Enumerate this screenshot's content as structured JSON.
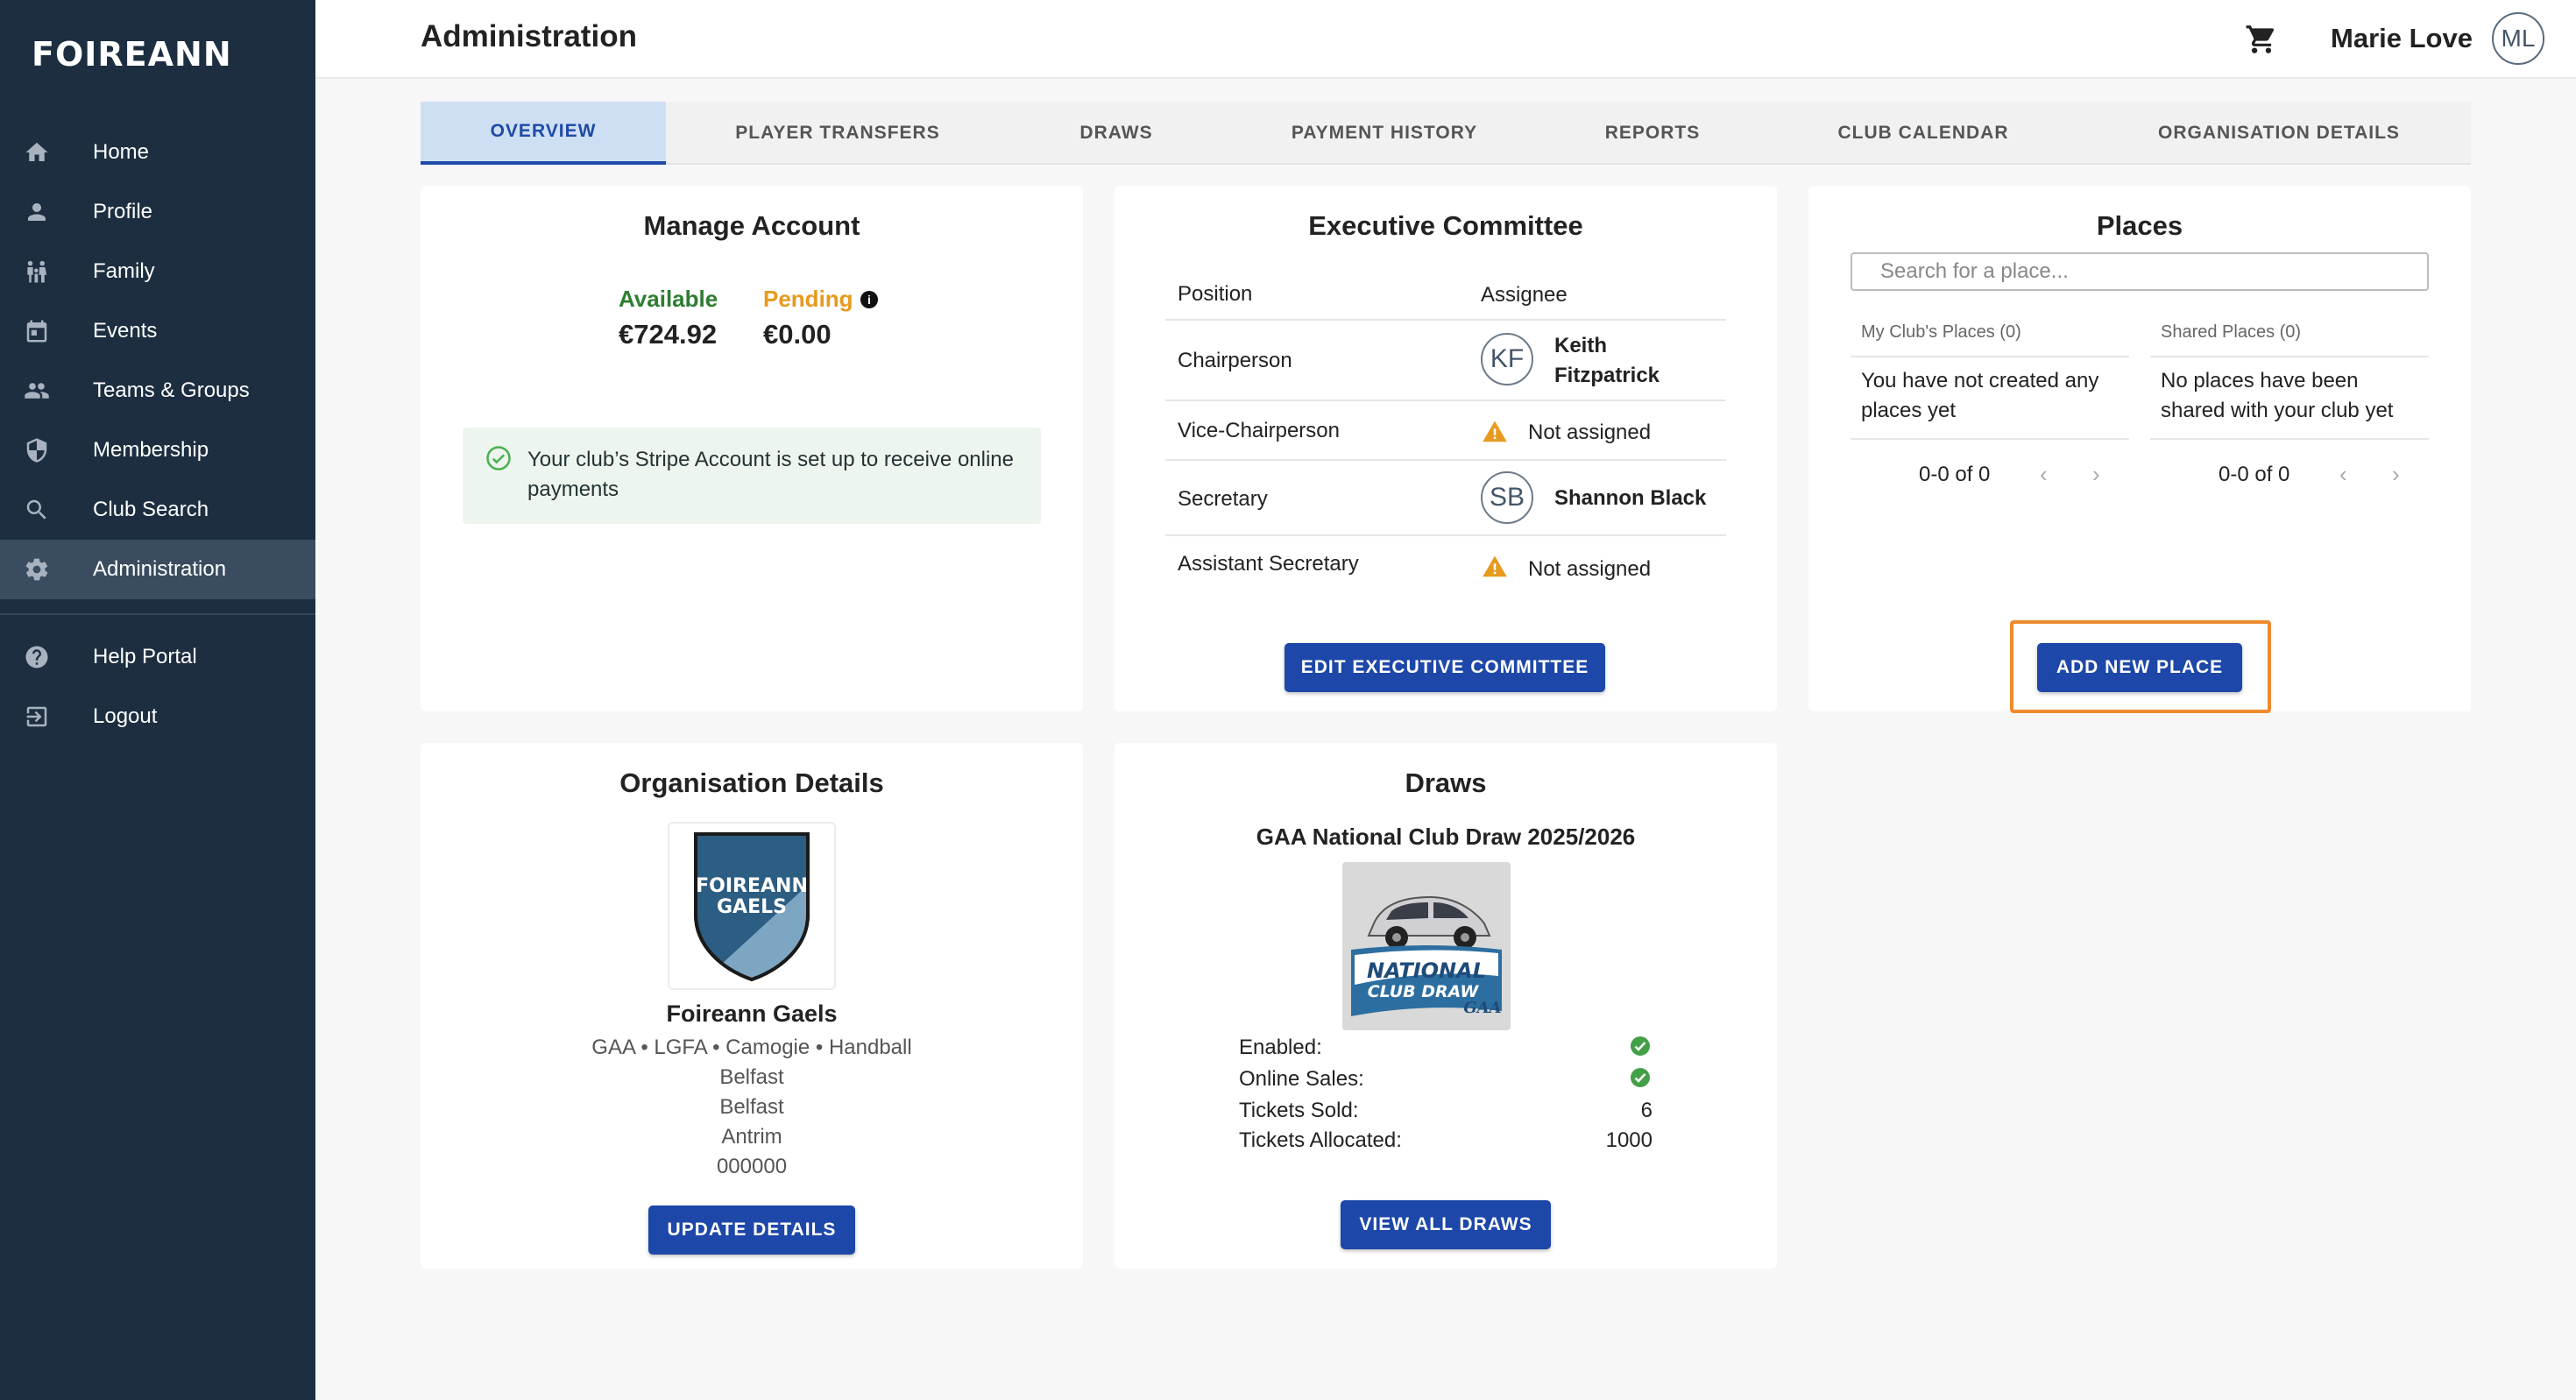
{
  "brand": "FOIREANN",
  "sidebar": {
    "items": [
      {
        "label": "Home",
        "icon": "home-icon"
      },
      {
        "label": "Profile",
        "icon": "person-icon"
      },
      {
        "label": "Family",
        "icon": "family-icon"
      },
      {
        "label": "Events",
        "icon": "calendar-icon"
      },
      {
        "label": "Teams & Groups",
        "icon": "group-icon"
      },
      {
        "label": "Membership",
        "icon": "shield-icon"
      },
      {
        "label": "Club Search",
        "icon": "search-icon"
      },
      {
        "label": "Administration",
        "icon": "gear-icon",
        "active": true
      }
    ],
    "secondary": [
      {
        "label": "Help Portal",
        "icon": "help-icon"
      },
      {
        "label": "Logout",
        "icon": "logout-icon"
      }
    ]
  },
  "header": {
    "title": "Administration",
    "user_name": "Marie Love",
    "user_initials": "ML"
  },
  "tabs": [
    {
      "label": "OVERVIEW",
      "active": true
    },
    {
      "label": "PLAYER TRANSFERS"
    },
    {
      "label": "DRAWS"
    },
    {
      "label": "PAYMENT HISTORY"
    },
    {
      "label": "REPORTS"
    },
    {
      "label": "CLUB CALENDAR"
    },
    {
      "label": "ORGANISATION DETAILS"
    }
  ],
  "manage_account": {
    "title": "Manage Account",
    "available_label": "Available",
    "available_value": "€724.92",
    "pending_label": "Pending",
    "pending_value": "€0.00",
    "stripe_message": "Your club’s Stripe Account is set up to receive online payments"
  },
  "executive_committee": {
    "title": "Executive Committee",
    "col_position": "Position",
    "col_assignee": "Assignee",
    "rows": [
      {
        "position": "Chairperson",
        "initials": "KF",
        "name": "Keith Fitzpatrick"
      },
      {
        "position": "Vice-Chairperson",
        "status": "Not assigned"
      },
      {
        "position": "Secretary",
        "initials": "SB",
        "name": "Shannon Black"
      },
      {
        "position": "Assistant Secretary",
        "status": "Not assigned"
      }
    ],
    "button": "EDIT EXECUTIVE COMMITTEE"
  },
  "places": {
    "title": "Places",
    "search_placeholder": "Search for a place...",
    "my_places_header": "My Club's Places (0)",
    "shared_places_header": "Shared Places (0)",
    "my_places_empty": "You have not created any places yet",
    "shared_places_empty": "No places have been shared with your club yet",
    "my_pager": "0-0 of 0",
    "shared_pager": "0-0 of 0",
    "button": "ADD NEW PLACE"
  },
  "organisation": {
    "title": "Organisation Details",
    "logo_line1": "FOIREANN",
    "logo_line2": "GAELS",
    "name": "Foireann Gaels",
    "codes": "GAA • LGFA • Camogie • Handball",
    "address1": "Belfast",
    "address2": "Belfast",
    "county": "Antrim",
    "postcode": "000000",
    "button": "UPDATE DETAILS"
  },
  "draws": {
    "title": "Draws",
    "draw_name": "GAA National Club Draw 2025/2026",
    "image_line1": "NATIONAL",
    "image_line2": "CLUB DRAW",
    "image_mark": "GAA",
    "enabled_label": "Enabled:",
    "online_sales_label": "Online Sales:",
    "tickets_sold_label": "Tickets Sold:",
    "tickets_sold": "6",
    "tickets_allocated_label": "Tickets Allocated:",
    "tickets_allocated": "1000",
    "button": "VIEW ALL DRAWS"
  },
  "colors": {
    "sidebar_bg": "#1c2e40",
    "primary_button": "#1d47a8",
    "available_green": "#2e7d32",
    "pending_orange": "#e79a1e",
    "highlight_orange": "#ef8a2e"
  }
}
